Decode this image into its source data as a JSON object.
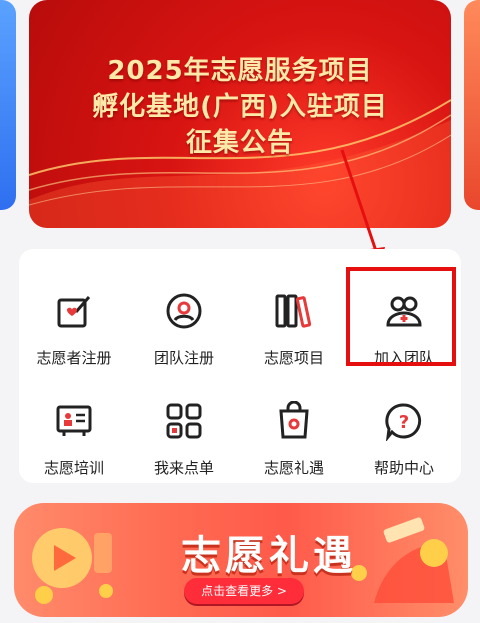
{
  "banner": {
    "line1": "2025年志愿服务项目",
    "line2": "孵化基地(广西)入驻项目",
    "line3": "征集公告"
  },
  "menu": {
    "items": [
      {
        "label": "志愿者注册",
        "icon": "volunteer-register-icon"
      },
      {
        "label": "团队注册",
        "icon": "team-register-icon"
      },
      {
        "label": "志愿项目",
        "icon": "volunteer-project-icon"
      },
      {
        "label": "加入团队",
        "icon": "join-team-icon"
      },
      {
        "label": "志愿培训",
        "icon": "volunteer-training-icon"
      },
      {
        "label": "我来点单",
        "icon": "order-icon"
      },
      {
        "label": "志愿礼遇",
        "icon": "gift-bag-icon"
      },
      {
        "label": "帮助中心",
        "icon": "help-icon"
      }
    ]
  },
  "promo": {
    "title": "志愿礼遇",
    "button": "点击查看更多 >"
  },
  "colors": {
    "accent": "#e83a3a",
    "highlight": "#e60f0f",
    "banner_text": "#ffe9a8"
  }
}
